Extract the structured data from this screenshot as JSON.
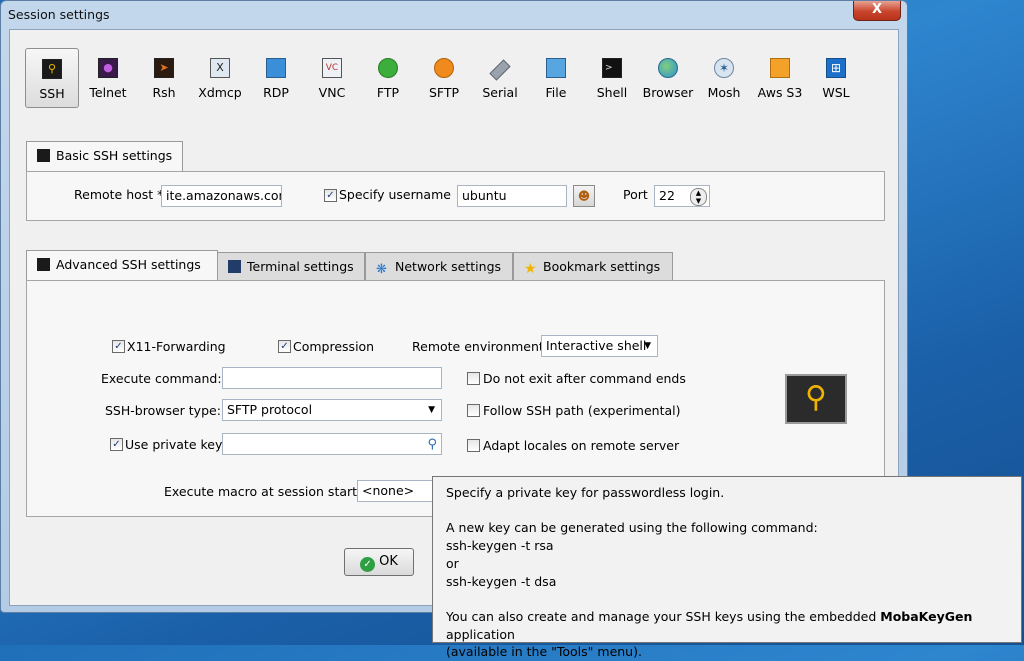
{
  "window": {
    "title": "Session settings",
    "close_label": "X"
  },
  "toolbar": {
    "items": [
      {
        "label": "SSH",
        "icon": "key-icon"
      },
      {
        "label": "Telnet",
        "icon": "telnet-icon"
      },
      {
        "label": "Rsh",
        "icon": "rsh-icon"
      },
      {
        "label": "Xdmcp",
        "icon": "xdmcp-icon"
      },
      {
        "label": "RDP",
        "icon": "rdp-monitor-icon"
      },
      {
        "label": "VNC",
        "icon": "vnc-icon"
      },
      {
        "label": "FTP",
        "icon": "ftp-globe-icon"
      },
      {
        "label": "SFTP",
        "icon": "sftp-globe-icon"
      },
      {
        "label": "Serial",
        "icon": "serial-cable-icon"
      },
      {
        "label": "File",
        "icon": "file-monitor-icon"
      },
      {
        "label": "Shell",
        "icon": "terminal-icon"
      },
      {
        "label": "Browser",
        "icon": "browser-globe-icon"
      },
      {
        "label": "Mosh",
        "icon": "satellite-icon"
      },
      {
        "label": "Aws S3",
        "icon": "aws-cubes-icon"
      },
      {
        "label": "WSL",
        "icon": "windows-logo-icon"
      }
    ],
    "selected": "SSH"
  },
  "basic": {
    "tab_label": "Basic SSH settings",
    "remote_host_label": "Remote host *",
    "remote_host_value": "ite.amazonaws.com",
    "specify_username_label": "Specify username",
    "specify_username_checked": true,
    "username_value": "ubuntu",
    "port_label": "Port",
    "port_value": "22"
  },
  "advanced_tabs": [
    {
      "label": "Advanced SSH settings"
    },
    {
      "label": "Terminal settings"
    },
    {
      "label": "Network settings"
    },
    {
      "label": "Bookmark settings"
    }
  ],
  "advanced": {
    "x11_label": "X11-Forwarding",
    "compression_label": "Compression",
    "remote_env_label": "Remote environment:",
    "remote_env_value": "Interactive shell",
    "execute_command_label": "Execute command:",
    "execute_command_value": "",
    "no_exit_label": "Do not exit after command ends",
    "browser_type_label": "SSH-browser type:",
    "browser_type_value": "SFTP protocol",
    "follow_path_label": "Follow SSH path (experimental)",
    "private_key_label": "Use private key",
    "private_key_value": "",
    "adapt_locales_label": "Adapt locales on remote server",
    "macro_label": "Execute macro at session start:",
    "macro_value": "<none>"
  },
  "ok_label": "OK",
  "tooltip": {
    "line1": "Specify a private key for passwordless login.",
    "line2": "A new key can be generated using the following command:",
    "line3": "ssh-keygen -t rsa",
    "line4": "or",
    "line5": "ssh-keygen -t dsa",
    "line6_prefix": "You can also create and manage your SSH keys using the embedded ",
    "line6_bold": "MobaKeyGen",
    "line6_suffix": " application",
    "line7": "(available in the \"Tools\" menu)."
  }
}
